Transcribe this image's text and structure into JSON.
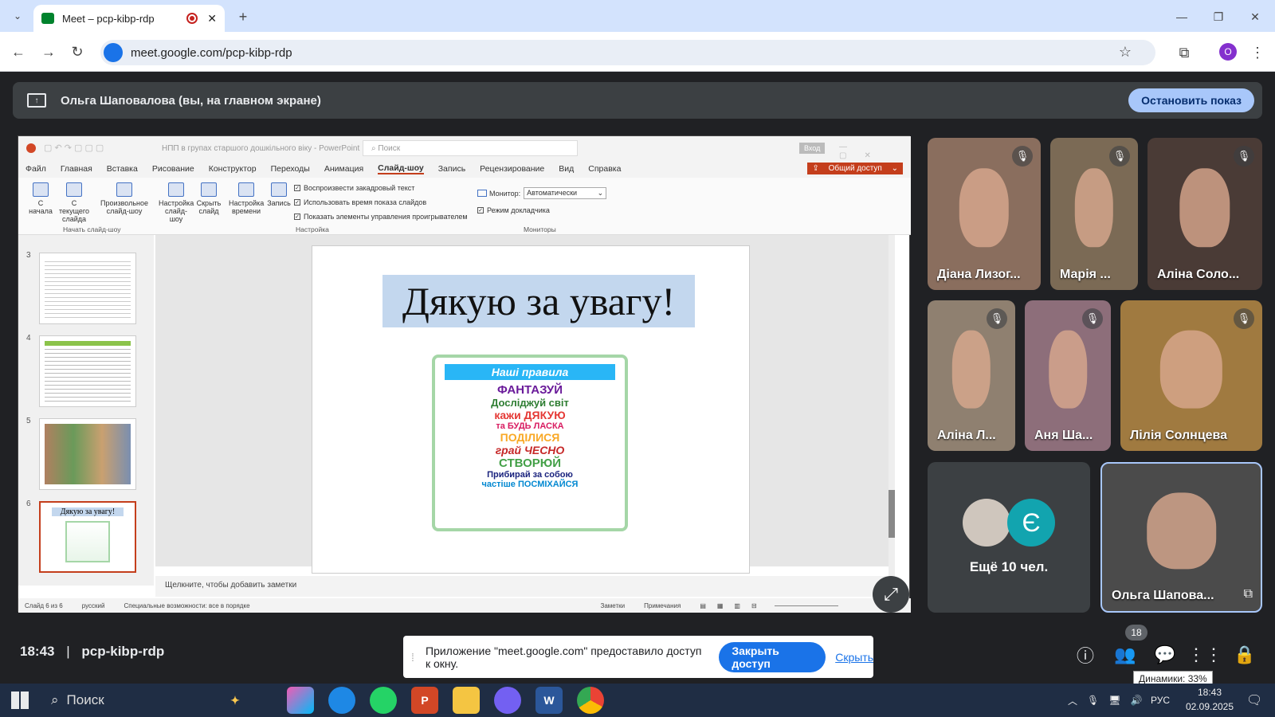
{
  "browser": {
    "tab_title": "Meet – pcp-kibp-rdp",
    "new_tab": "+",
    "url": "meet.google.com/pcp-kibp-rdp",
    "profile_initial": "O"
  },
  "banner": {
    "presenter_text": "Ольга Шаповалова (вы, на главном экране)",
    "stop_button": "Остановить показ"
  },
  "ppt": {
    "title": "НПП в групах старшого дошкільного віку - PowerPoint",
    "search_placeholder": "Поиск",
    "login": "Вход",
    "share": "Общий доступ",
    "menu": [
      "Файл",
      "Главная",
      "Вставка",
      "Рисование",
      "Конструктор",
      "Переходы",
      "Анимация",
      "Слайд-шоу",
      "Запись",
      "Рецензирование",
      "Вид",
      "Справка"
    ],
    "ribbon_buttons": [
      "С начала",
      "С текущего слайда",
      "Произвольное слайд-шоу",
      "Настройка слайд-шоу",
      "Скрыть слайд",
      "Настройка времени",
      "Запись"
    ],
    "group_start": "Начать слайд-шоу",
    "group_setup": "Настройка",
    "group_monitors": "Мониторы",
    "checks": [
      "Воспроизвести закадровый текст",
      "Использовать время показа слайдов",
      "Показать элементы управления проигрывателем"
    ],
    "monitor_label": "Монитор:",
    "monitor_value": "Автоматически",
    "presenter_mode": "Режим докладчика",
    "slide_nums": [
      "3",
      "4",
      "5",
      "6"
    ],
    "thumb6_title": "Дякую за увагу!",
    "slide_title": "Дякую за увагу!",
    "poster": {
      "header": "Наші правила",
      "lines": [
        "ФАНТАЗУЙ",
        "Досліджуй світ",
        "кажи ДЯКУЮ",
        "та БУДЬ ЛАСКА",
        "ПОДІЛИСЯ",
        "грай ЧЕСНО",
        "СТВОРЮЙ",
        "Прибирай за собою",
        "частіше ПОСМІХАЙСЯ"
      ]
    },
    "notes_placeholder": "Щелкните, чтобы добавить заметки",
    "status_slide": "Слайд 6 из 6",
    "status_lang": "русский",
    "status_access": "Специальные возможности: все в порядке",
    "status_notes": "Заметки",
    "status_comments": "Примечания"
  },
  "participants": [
    {
      "name": "Діана Лизог..."
    },
    {
      "name": "Марія ..."
    },
    {
      "name": "Аліна Соло..."
    },
    {
      "name": "Аліна Л..."
    },
    {
      "name": "Аня Ша..."
    },
    {
      "name": "Лілія Солнцева"
    }
  ],
  "more": {
    "avatar_letter": "Є",
    "text": "Ещё 10 чел."
  },
  "self_tile": {
    "name": "Ольга Шапова..."
  },
  "bottom": {
    "time": "18:43",
    "separator": "|",
    "code": "pcp-kibp-rdp",
    "participant_count": "18",
    "tooltip": "Динамики: 33%"
  },
  "toast": {
    "text": "Приложение \"meet.google.com\" предоставило доступ к окну.",
    "close_button": "Закрыть доступ",
    "hide_link": "Скрыть"
  },
  "taskbar": {
    "search": "Поиск",
    "lang": "РУС",
    "time": "18:43",
    "date": "02.09.2025"
  }
}
